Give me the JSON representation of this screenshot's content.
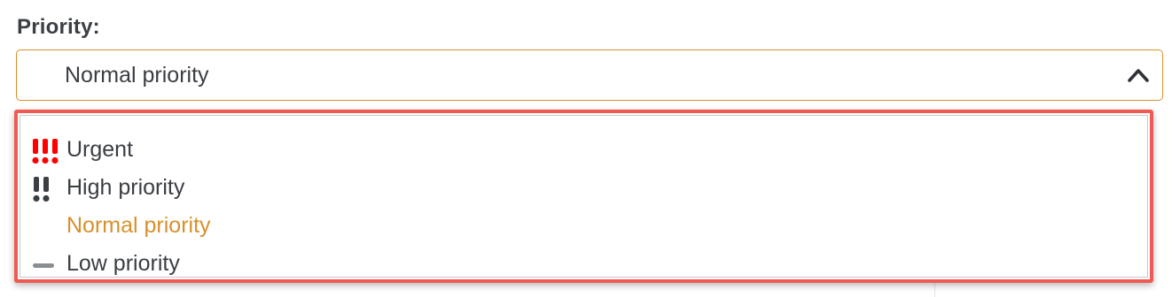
{
  "field": {
    "label": "Priority:",
    "selected_value": "Normal priority",
    "accent_color": "#d8902b"
  },
  "dropdown": {
    "highlight_color": "#f05a52",
    "options": [
      {
        "label": "Urgent",
        "icon": "triple-exclamation-icon",
        "icon_color": "#ff0000",
        "selected": false
      },
      {
        "label": "High priority",
        "icon": "double-exclamation-icon",
        "icon_color": "#3b3f44",
        "selected": false
      },
      {
        "label": "Normal priority",
        "icon": "",
        "selected": true
      },
      {
        "label": "Low priority",
        "icon": "dash-icon",
        "icon_color": "#8a8d91",
        "selected": false
      }
    ]
  }
}
